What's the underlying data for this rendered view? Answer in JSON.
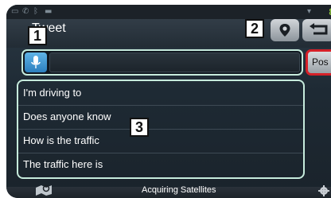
{
  "header": {
    "title": "Tweet",
    "location_icon": "location-pin-icon",
    "back_icon": "return-arrow-icon"
  },
  "status_bar": {
    "time_partial": "8"
  },
  "input": {
    "mic_icon": "microphone-icon",
    "value": "",
    "post_label": "Pos"
  },
  "phrases": [
    "I'm driving to",
    "Does anyone know",
    "How is the traffic",
    "The traffic here is"
  ],
  "callouts": [
    "1",
    "2",
    "3"
  ],
  "footer": {
    "status": "Acquiring Satellites",
    "map_icon": "map-search-icon",
    "settings_icon": "gear-icon"
  },
  "colors": {
    "highlight_border": "#c6ebdc",
    "post_border": "#d62028",
    "mic_button": "#2c7fbe",
    "clock": "#8fc63f"
  }
}
